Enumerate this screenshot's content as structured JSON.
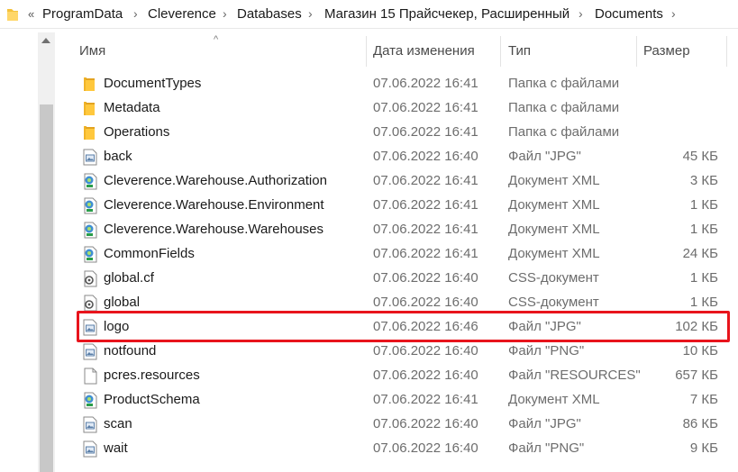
{
  "breadcrumb": {
    "more": "«",
    "items": [
      "ProgramData",
      "Cleverence",
      "Databases",
      "Магазин 15 Прайсчекер, Расширенный",
      "Documents"
    ]
  },
  "columns": {
    "name": "Имя",
    "date": "Дата изменения",
    "type": "Тип",
    "size": "Размер"
  },
  "files": [
    {
      "name": "DocumentTypes",
      "date": "07.06.2022 16:41",
      "type": "Папка с файлами",
      "size": "",
      "icon": "folder-icon"
    },
    {
      "name": "Metadata",
      "date": "07.06.2022 16:41",
      "type": "Папка с файлами",
      "size": "",
      "icon": "folder-icon"
    },
    {
      "name": "Operations",
      "date": "07.06.2022 16:41",
      "type": "Папка с файлами",
      "size": "",
      "icon": "folder-icon"
    },
    {
      "name": "back",
      "date": "07.06.2022 16:40",
      "type": "Файл \"JPG\"",
      "size": "45 КБ",
      "icon": "image-file-icon"
    },
    {
      "name": "Cleverence.Warehouse.Authorization",
      "date": "07.06.2022 16:41",
      "type": "Документ XML",
      "size": "3 КБ",
      "icon": "xml-file-icon"
    },
    {
      "name": "Cleverence.Warehouse.Environment",
      "date": "07.06.2022 16:41",
      "type": "Документ XML",
      "size": "1 КБ",
      "icon": "xml-file-icon"
    },
    {
      "name": "Cleverence.Warehouse.Warehouses",
      "date": "07.06.2022 16:41",
      "type": "Документ XML",
      "size": "1 КБ",
      "icon": "xml-file-icon"
    },
    {
      "name": "CommonFields",
      "date": "07.06.2022 16:41",
      "type": "Документ XML",
      "size": "24 КБ",
      "icon": "xml-file-icon"
    },
    {
      "name": "global.cf",
      "date": "07.06.2022 16:40",
      "type": "CSS-документ",
      "size": "1 КБ",
      "icon": "css-file-icon"
    },
    {
      "name": "global",
      "date": "07.06.2022 16:40",
      "type": "CSS-документ",
      "size": "1 КБ",
      "icon": "css-file-icon"
    },
    {
      "name": "logo",
      "date": "07.06.2022 16:46",
      "type": "Файл \"JPG\"",
      "size": "102 КБ",
      "icon": "image-file-icon"
    },
    {
      "name": "notfound",
      "date": "07.06.2022 16:40",
      "type": "Файл \"PNG\"",
      "size": "10 КБ",
      "icon": "image-file-icon"
    },
    {
      "name": "pcres.resources",
      "date": "07.06.2022 16:40",
      "type": "Файл \"RESOURCES\"",
      "size": "657 КБ",
      "icon": "blank-file-icon"
    },
    {
      "name": "ProductSchema",
      "date": "07.06.2022 16:41",
      "type": "Документ XML",
      "size": "7 КБ",
      "icon": "xml-file-icon"
    },
    {
      "name": "scan",
      "date": "07.06.2022 16:40",
      "type": "Файл \"JPG\"",
      "size": "86 КБ",
      "icon": "image-file-icon"
    },
    {
      "name": "wait",
      "date": "07.06.2022 16:40",
      "type": "Файл \"PNG\"",
      "size": "9 КБ",
      "icon": "image-file-icon"
    }
  ],
  "colors": {
    "highlight": "#e8141c",
    "folder": "#f4c23b"
  }
}
